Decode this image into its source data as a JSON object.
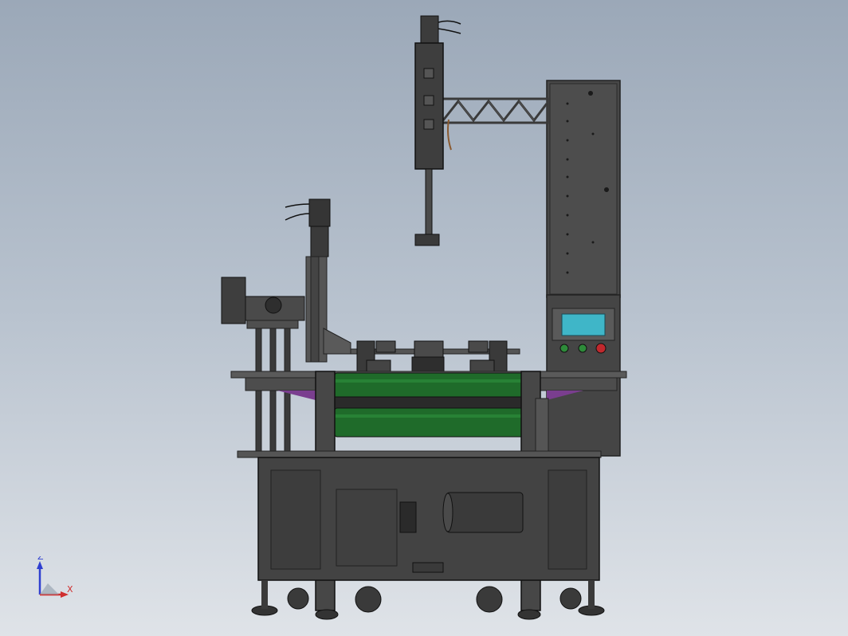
{
  "viewport": {
    "background_top": "#9ba8b8",
    "background_bottom": "#dfe3e8"
  },
  "model": {
    "frame_color": "#4a4a4a",
    "conveyor_belt_color": "#1f6b2a",
    "hmi_screen_color": "#3fb6c8",
    "accent_color": "#7a3e8f",
    "control_buttons": [
      {
        "icon": "green-button-icon",
        "color": "#2e8b3a"
      },
      {
        "icon": "green-button-icon",
        "color": "#2e8b3a"
      },
      {
        "icon": "emergency-stop-icon",
        "color": "#c0282d"
      }
    ]
  },
  "triad": {
    "z_label": "Z",
    "x_label": "X",
    "z_color": "#2f3fd0",
    "x_color": "#d02f2f"
  }
}
